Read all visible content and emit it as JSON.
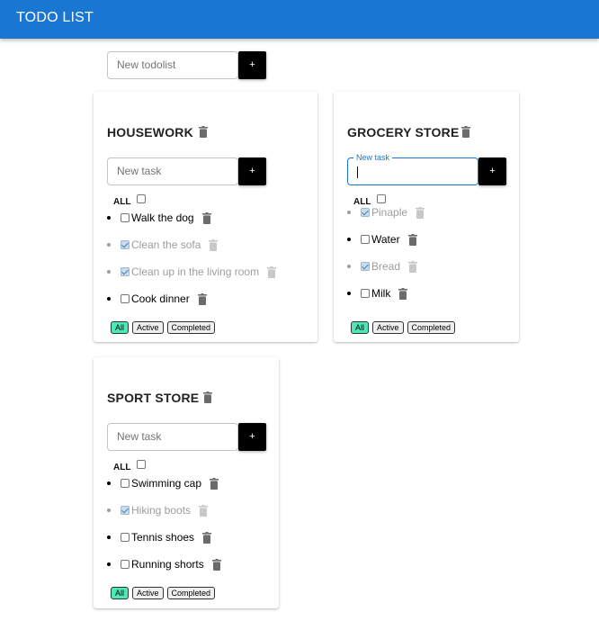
{
  "app": {
    "title": "TODO LIST"
  },
  "new_list": {
    "placeholder": "New todolist",
    "add_label": "+"
  },
  "common": {
    "all_label": "ALL",
    "filters": [
      "All",
      "Active",
      "Completed"
    ],
    "active_filter": "All",
    "new_task_placeholder": "New task",
    "add_label": "+"
  },
  "lists": [
    {
      "title": "HOUSEWORK",
      "input_label": "",
      "tasks": [
        {
          "label": "Walk the dog",
          "done": false
        },
        {
          "label": "Clean the sofa",
          "done": true
        },
        {
          "label": "Clean up in the living room",
          "done": true
        },
        {
          "label": "Cook dinner",
          "done": false
        }
      ]
    },
    {
      "title": "GROCERY STORE",
      "input_label": "New task",
      "focused": true,
      "tasks": [
        {
          "label": "Pinaple",
          "done": true
        },
        {
          "label": "Water",
          "done": false
        },
        {
          "label": "Bread",
          "done": true
        },
        {
          "label": "Milk",
          "done": false
        }
      ]
    },
    {
      "title": "SPORT STORE",
      "input_label": "",
      "tasks": [
        {
          "label": "Swimming cap",
          "done": false
        },
        {
          "label": "Hiking boots",
          "done": true
        },
        {
          "label": "Tennis shoes",
          "done": false
        },
        {
          "label": "Running shorts",
          "done": false
        }
      ]
    }
  ],
  "colors": {
    "appbar": "#1976d2",
    "active_filter": "#4de8b8",
    "add_button": "#000000",
    "done_text": "#9e9e9e"
  }
}
